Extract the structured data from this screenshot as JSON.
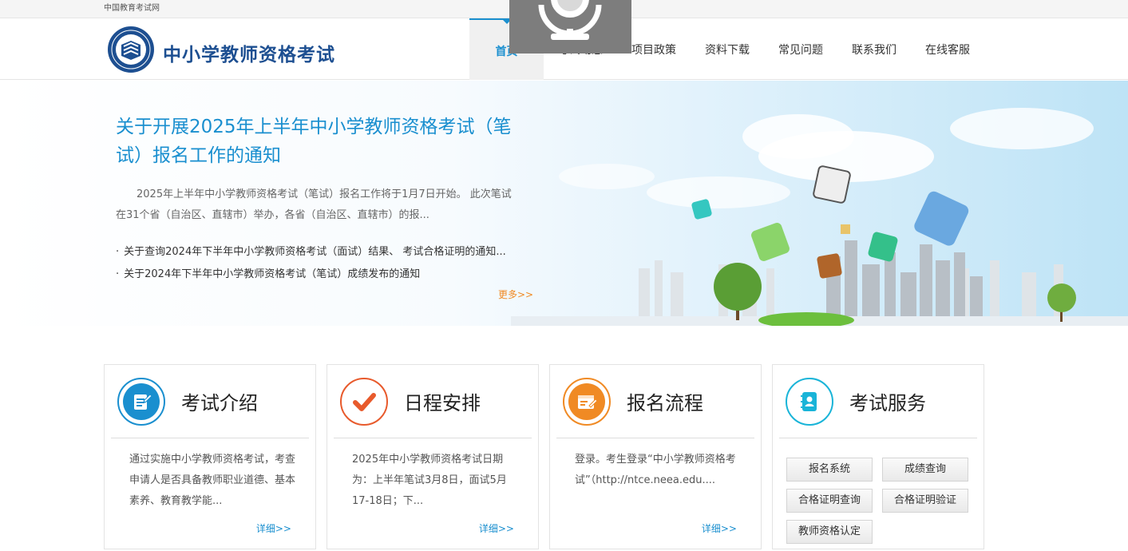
{
  "topbar": {
    "site_name": "中国教育考试网"
  },
  "header": {
    "brand": "中小学教师资格考试",
    "nav": [
      {
        "label": "首页",
        "active": true
      },
      {
        "label": "考试动态"
      },
      {
        "label": "项目政策"
      },
      {
        "label": "资料下载"
      },
      {
        "label": "常见问题"
      },
      {
        "label": "联系我们"
      },
      {
        "label": "在线客服"
      }
    ]
  },
  "banner": {
    "headline": "关于开展2025年上半年中小学教师资格考试（笔试）报名工作的通知",
    "summary": "2025年上半年中小学教师资格考试（笔试）报名工作将于1月7日开始。 此次笔试在31个省（自治区、直辖市）举办，各省（自治区、直辖市）的报...",
    "news": [
      "关于查询2024年下半年中小学教师资格考试（面试）结果、 考试合格证明的通知...",
      "关于2024年下半年中小学教师资格考试（笔试）成绩发布的通知"
    ],
    "more": "更多>>"
  },
  "cards": [
    {
      "title": "考试介绍",
      "icon": "edit-document-icon",
      "color": "#1a8fcf",
      "body": "通过实施中小学教师资格考试，考查申请人是否具备教师职业道德、基本素养、教育教学能...",
      "more": "详细>>"
    },
    {
      "title": "日程安排",
      "icon": "checkmark-icon",
      "color": "#e85a2c",
      "body": "2025年中小学教师资格考试日期为：上半年笔试3月8日，面试5月17-18日；下...",
      "more": "详细>>"
    },
    {
      "title": "报名流程",
      "icon": "application-form-icon",
      "color": "#f08a24",
      "body": "登录。考生登录“中小学教师资格考试”（http://ntce.neea.edu....",
      "more": "详细>>"
    },
    {
      "title": "考试服务",
      "icon": "address-book-icon",
      "color": "#19b4d8",
      "services": [
        "报名系统",
        "成绩查询",
        "合格证明查询",
        "合格证明验证",
        "教师资格认定"
      ]
    }
  ]
}
